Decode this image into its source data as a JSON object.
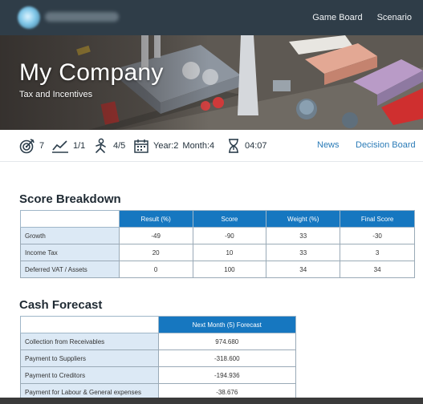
{
  "nav": {
    "links": [
      "Game Board",
      "Scenario"
    ]
  },
  "hero": {
    "company_name": "My Company",
    "subtitle": "Tax and Incentives"
  },
  "status": {
    "targets": "7",
    "trend": "1/1",
    "team": "4/5",
    "year": "Year:2",
    "month": "Month:4",
    "time": "04:07",
    "links": [
      "News",
      "Decision Board"
    ]
  },
  "score_breakdown": {
    "title": "Score Breakdown",
    "headers": [
      "Result (%)",
      "Score",
      "Weight (%)",
      "Final Score"
    ],
    "rows": [
      {
        "label": "Growth",
        "values": [
          "-49",
          "-90",
          "33",
          "-30"
        ]
      },
      {
        "label": "Income Tax",
        "values": [
          "20",
          "10",
          "33",
          "3"
        ]
      },
      {
        "label": "Deferred VAT / Assets",
        "values": [
          "0",
          "100",
          "34",
          "34"
        ]
      }
    ]
  },
  "cash_forecast": {
    "title": "Cash Forecast",
    "header": "Next Month (5) Forecast",
    "rows": [
      {
        "label": "Collection from Receivables",
        "value": "974.680"
      },
      {
        "label": "Payment to Suppliers",
        "value": "-318.600"
      },
      {
        "label": "Payment to Creditors",
        "value": "-194.936"
      },
      {
        "label": "Payment for Labour & General expenses",
        "value": "-38.676"
      }
    ]
  },
  "colors": {
    "topbar": "#2f3d48",
    "header_blue": "#1677c0",
    "row_label_bg": "#dce9f5",
    "link": "#2a7bb7"
  },
  "icons": [
    "target-icon",
    "trend-chart-icon",
    "team-icon",
    "calendar-icon",
    "hourglass-icon"
  ]
}
